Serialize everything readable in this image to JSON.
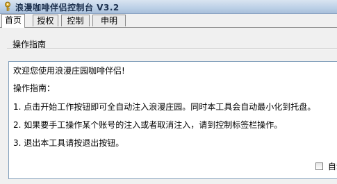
{
  "window": {
    "title": "浪漫咖啡伴侣控制台 V3.2",
    "icon": "key-icon"
  },
  "tabs": [
    {
      "label": "首页",
      "active": true
    },
    {
      "label": "授权",
      "active": false
    },
    {
      "label": "控制",
      "active": false
    },
    {
      "label": "申明",
      "active": false
    }
  ],
  "main": {
    "group_label": "操作指南",
    "text_lines": [
      "欢迎您使用浪漫庄园咖啡伴侣!",
      "操作指南：",
      "1. 点击开始工作按钮即可全自动注入浪漫庄园。同时本工具会自动最小化到托盘。",
      "2. 如果要手工操作某个账号的注入或者取消注入，请到控制标签栏操作。",
      "3. 退出本工具请按退出按钮。"
    ],
    "checkbox_label": "自动",
    "checkbox_checked": false
  }
}
